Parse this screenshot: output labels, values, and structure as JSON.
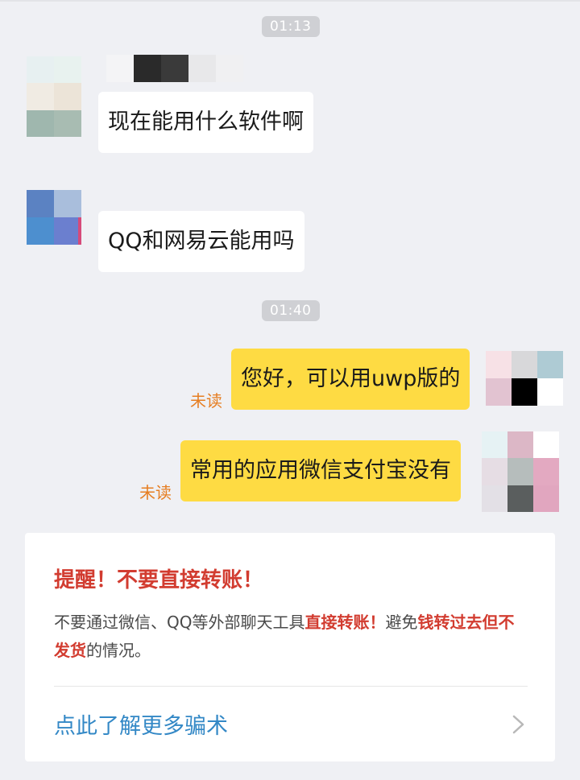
{
  "timestamps": [
    "01:13",
    "01:40"
  ],
  "messages": [
    {
      "side": "in",
      "text": "现在能用什么软件啊"
    },
    {
      "side": "in",
      "text": "QQ和网易云能用吗"
    },
    {
      "side": "out",
      "text": "您好，可以用uwp版的",
      "status": "未读"
    },
    {
      "side": "out",
      "text": "常用的应用微信支付宝没有",
      "status": "未读"
    }
  ],
  "notice": {
    "title": "提醒！不要直接转账！",
    "body_part1": "不要通过微信、QQ等外部聊天工具",
    "body_highlight1": "直接转账！",
    "body_part2": "避免",
    "body_highlight2": "钱转过去但不发货",
    "body_part3": "的情况。",
    "link_label": "点此了解更多骗术"
  },
  "colors": {
    "background": "#eff0f4",
    "outgoing_bubble": "#fedb43",
    "incoming_bubble": "#ffffff",
    "warning_red": "#d23c30",
    "link_blue": "#3388c6",
    "unread_orange": "#e67e22"
  }
}
